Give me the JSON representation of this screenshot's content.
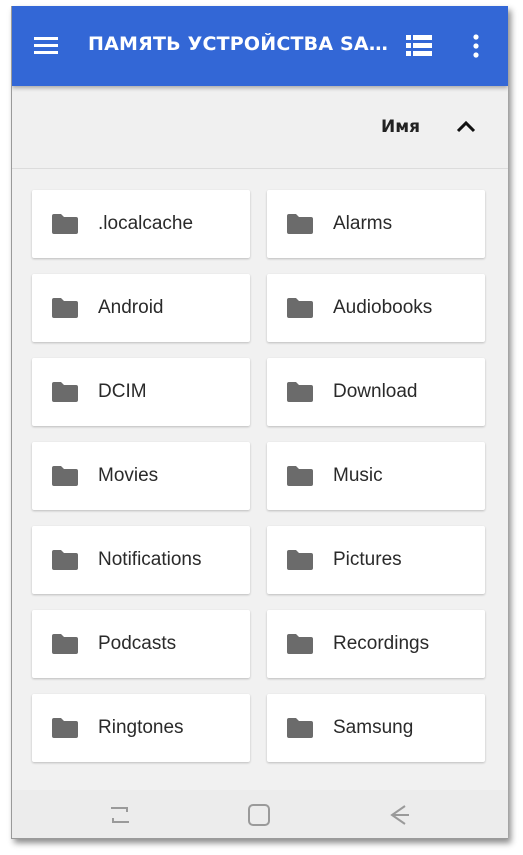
{
  "app": {
    "title": "ПАМЯТЬ УСТРОЙСТВА SAMSUNG",
    "accent_color": "#3367d6"
  },
  "toolbar": {
    "menu_icon": "hamburger-menu-icon",
    "list_view_icon": "list-view-icon",
    "more_icon": "more-vert-icon"
  },
  "sort": {
    "label": "Имя",
    "direction_icon": "chevron-up-icon"
  },
  "folders": [
    {
      "name": ".localcache"
    },
    {
      "name": "Alarms"
    },
    {
      "name": "Android"
    },
    {
      "name": "Audiobooks"
    },
    {
      "name": "DCIM"
    },
    {
      "name": "Download"
    },
    {
      "name": "Movies"
    },
    {
      "name": "Music"
    },
    {
      "name": "Notifications"
    },
    {
      "name": "Pictures"
    },
    {
      "name": "Podcasts"
    },
    {
      "name": "Recordings"
    },
    {
      "name": "Ringtones"
    },
    {
      "name": "Samsung"
    }
  ],
  "navbar": {
    "recents_icon": "recent-apps-icon",
    "home_icon": "home-icon",
    "back_icon": "back-icon"
  }
}
